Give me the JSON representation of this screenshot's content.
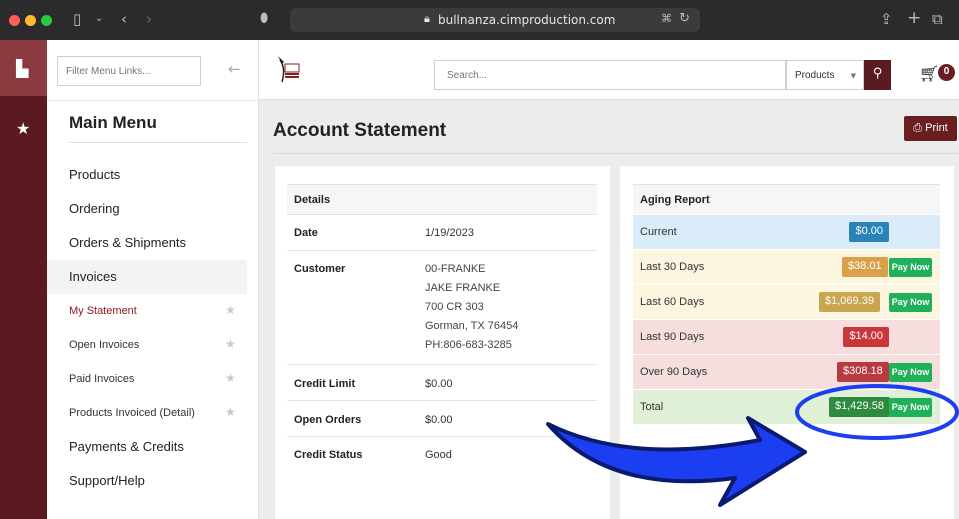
{
  "browser": {
    "url": "bullnanza.cimproduction.com",
    "colors": {
      "close": "#ff5f57",
      "minimize": "#febc2e",
      "zoom": "#28c840"
    }
  },
  "sidebar": {
    "filter_placeholder": "Filter Menu Links...",
    "menu_title": "Main Menu",
    "items": [
      {
        "label": "Products",
        "type": "section"
      },
      {
        "label": "Ordering",
        "type": "section"
      },
      {
        "label": "Orders & Shipments",
        "type": "section"
      },
      {
        "label": "Invoices",
        "type": "section",
        "active": true
      },
      {
        "label": "My Statement",
        "type": "sub",
        "current": true
      },
      {
        "label": "Open Invoices",
        "type": "sub"
      },
      {
        "label": "Paid Invoices",
        "type": "sub"
      },
      {
        "label": "Products Invoiced (Detail)",
        "type": "sub"
      },
      {
        "label": "Payments & Credits",
        "type": "section"
      },
      {
        "label": "Support/Help",
        "type": "section"
      }
    ]
  },
  "header": {
    "search_placeholder": "Search...",
    "search_scope": "Products",
    "cart_count": "0"
  },
  "page": {
    "title": "Account Statement",
    "print_label": "Print"
  },
  "details": {
    "header": "Details",
    "date_label": "Date",
    "date_value": "1/19/2023",
    "customer_label": "Customer",
    "customer_lines": [
      "00-FRANKE",
      "JAKE FRANKE",
      "700 CR 303",
      "Gorman, TX 76454",
      "PH:806-683-3285"
    ],
    "credit_limit_label": "Credit Limit",
    "credit_limit_value": "$0.00",
    "open_orders_label": "Open Orders",
    "open_orders_value": "$0.00",
    "credit_status_label": "Credit Status",
    "credit_status_value": "Good"
  },
  "aging": {
    "header": "Aging Report",
    "pay_now_label": "Pay Now",
    "rows": [
      {
        "label": "Current",
        "amount": "$0.00",
        "bg": "#d9ecf7",
        "badge": "#2a83b5",
        "pay": false
      },
      {
        "label": "Last 30 Days",
        "amount": "$38.01",
        "bg": "#fcf5df",
        "badge": "#d9a14a",
        "pay": true
      },
      {
        "label": "Last 60 Days",
        "amount": "$1,069.39",
        "bg": "#fcf5df",
        "badge": "#c9a54f",
        "pay": true
      },
      {
        "label": "Last 90 Days",
        "amount": "$14.00",
        "bg": "#f5dedd",
        "badge": "#c9373b",
        "pay": false
      },
      {
        "label": "Over 90 Days",
        "amount": "$308.18",
        "bg": "#f5dedd",
        "badge": "#b63a3e",
        "pay": true
      },
      {
        "label": "Total",
        "amount": "$1,429.58",
        "bg": "#dff0d7",
        "badge": "#2e8a3c",
        "pay": true
      }
    ]
  }
}
